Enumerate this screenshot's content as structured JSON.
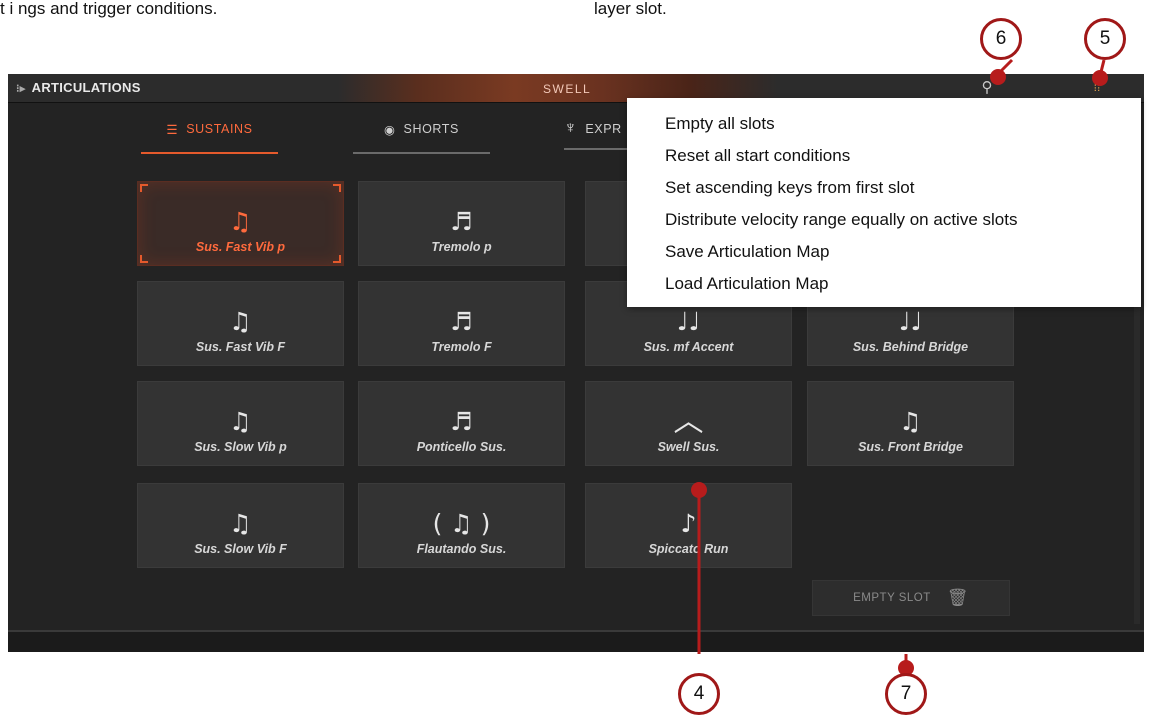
{
  "doc": {
    "top_left_text": "t i ngs and trigger conditions.",
    "top_right_text": "layer slot."
  },
  "header": {
    "title": "ARTICULATIONS",
    "center_label": "SWELL"
  },
  "tabs": [
    {
      "label": "SUSTAINS",
      "active": true,
      "icon": "sustain-lines-icon"
    },
    {
      "label": "SHORTS",
      "active": false,
      "icon": "target-icon"
    },
    {
      "label": "EXPR",
      "active": false,
      "icon": "conductor-icon"
    }
  ],
  "slots": [
    {
      "label": "Sus. Fast Vib p",
      "icon": "sustain-fast-vib-icon",
      "selected": true
    },
    {
      "label": "Tremolo p",
      "icon": "tremolo-icon"
    },
    {
      "label": "",
      "icon": ""
    },
    {
      "label": "",
      "icon": ""
    },
    {
      "label": "Sus. Fast Vib F",
      "icon": "sustain-fast-vib-icon"
    },
    {
      "label": "Tremolo F",
      "icon": "tremolo-icon"
    },
    {
      "label": "Sus. mf Accent",
      "icon": "sustain-accent-icon"
    },
    {
      "label": "Sus. Behind Bridge",
      "icon": "sustain-bridge-icon"
    },
    {
      "label": "Sus. Slow Vib p",
      "icon": "sustain-slow-vib-icon"
    },
    {
      "label": "Ponticello Sus.",
      "icon": "ponticello-icon"
    },
    {
      "label": "Swell Sus.",
      "icon": "swell-arc-icon"
    },
    {
      "label": "Sus. Front Bridge",
      "icon": "sustain-front-bridge-icon"
    },
    {
      "label": "Sus. Slow Vib F",
      "icon": "sustain-slow-vib-icon"
    },
    {
      "label": "Flautando Sus.",
      "icon": "flautando-icon"
    },
    {
      "label": "Spiccato Run",
      "icon": "spiccato-icon"
    }
  ],
  "empty_slot": {
    "label": "EMPTY SLOT",
    "icon": "trash-icon"
  },
  "context_menu": {
    "items": [
      "Empty all slots",
      "Reset all start conditions",
      "Set ascending keys from first slot",
      "Distribute velocity range equally on active slots",
      "Save Articulation Map",
      "Load Articulation Map"
    ]
  },
  "callouts": {
    "c4": "4",
    "c5": "5",
    "c6": "6",
    "c7": "7"
  },
  "colors": {
    "accent": "#e55a2c",
    "callout": "#a01818",
    "panel": "#232323",
    "tile": "#333333"
  }
}
